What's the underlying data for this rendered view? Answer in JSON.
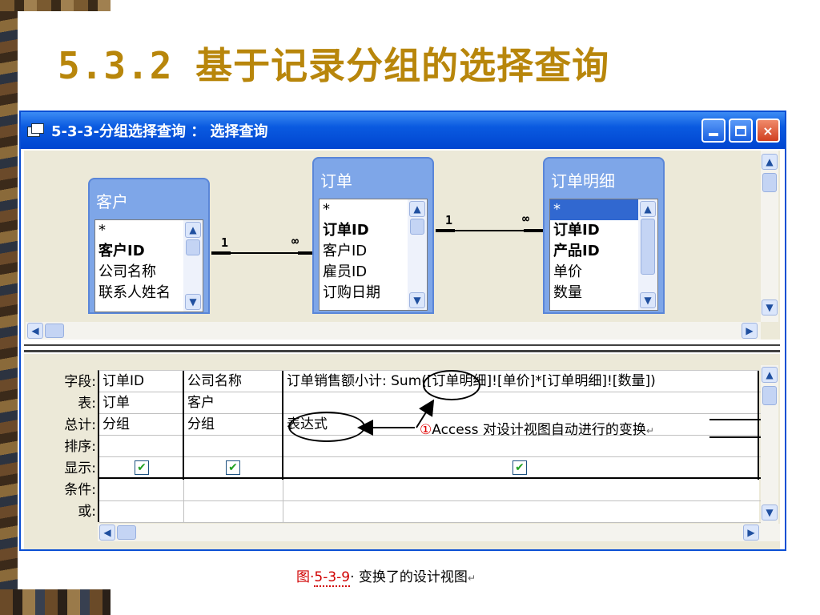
{
  "slide": {
    "title": "5.3.2 基于记录分组的选择查询",
    "caption_prefix": "图·",
    "caption_num": "5-3-9",
    "caption_text": "· 变换了的设计视图",
    "caption_mark": "↵"
  },
  "window": {
    "title": "5-3-3-分组选择查询 ： 选择查询",
    "buttons": {
      "minimize": "minimize",
      "maximize": "maximize",
      "close": "×"
    }
  },
  "tables": [
    {
      "name": "客户",
      "fields": [
        {
          "label": "*",
          "bold": false
        },
        {
          "label": "客户ID",
          "bold": true
        },
        {
          "label": "公司名称",
          "bold": false
        },
        {
          "label": "联系人姓名",
          "bold": false
        }
      ]
    },
    {
      "name": "订单",
      "fields": [
        {
          "label": "*",
          "bold": false
        },
        {
          "label": "订单ID",
          "bold": true
        },
        {
          "label": "客户ID",
          "bold": false
        },
        {
          "label": "雇员ID",
          "bold": false
        },
        {
          "label": "订购日期",
          "bold": false
        }
      ]
    },
    {
      "name": "订单明细",
      "fields": [
        {
          "label": "*",
          "bold": false
        },
        {
          "label": "订单ID",
          "bold": true
        },
        {
          "label": "产品ID",
          "bold": true
        },
        {
          "label": "单价",
          "bold": false
        },
        {
          "label": "数量",
          "bold": false
        }
      ]
    }
  ],
  "relations": [
    {
      "one": "1",
      "many": "∞"
    },
    {
      "one": "1",
      "many": "∞"
    }
  ],
  "grid": {
    "row_labels": [
      "字段:",
      "表:",
      "总计:",
      "排序:",
      "显示:",
      "条件:",
      "或:"
    ],
    "columns": [
      {
        "field": "订单ID",
        "table": "订单",
        "total": "分组",
        "sort": "",
        "show": true
      },
      {
        "field": "公司名称",
        "table": "客户",
        "total": "分组",
        "sort": "",
        "show": true
      },
      {
        "field": "订单销售额小计: Sum([订单明细]![单价]*[订单明细]![数量])",
        "table": "",
        "total": "表达式",
        "sort": "",
        "show": true
      }
    ]
  },
  "annotation": {
    "num": "①",
    "text": "Access 对设计视图自动进行的变换",
    "mark": "↵"
  },
  "icons": {
    "scroll_up": "chevron-up-icon",
    "scroll_down": "chevron-down-icon",
    "scroll_left": "chevron-left-icon",
    "scroll_right": "chevron-right-icon",
    "window": "window-icon",
    "check": "checkbox-checked-icon"
  },
  "colors": {
    "title": "#b8860b",
    "titlebar": "#0a5ae0",
    "table_header": "#7ea6e8",
    "selected": "#3168d0",
    "annotation_number": "#e00000"
  }
}
